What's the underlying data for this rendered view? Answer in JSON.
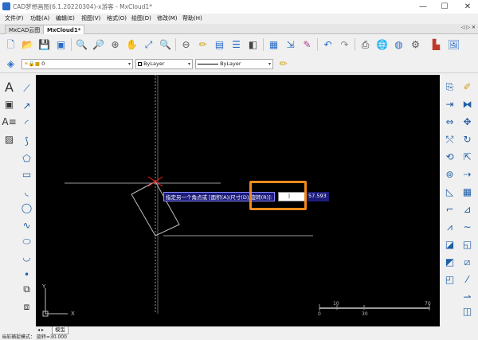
{
  "window": {
    "title": "CAD梦想画图(6.1.20220304)-x游客 - MxCloud1*",
    "minimize": "—",
    "maximize": "☐",
    "close": "✕"
  },
  "menu": [
    {
      "label": "文件(F)"
    },
    {
      "label": "功能(A)"
    },
    {
      "label": "编辑(E)"
    },
    {
      "label": "视图(V)"
    },
    {
      "label": "格式(O)"
    },
    {
      "label": "绘图(D)"
    },
    {
      "label": "修改(M)"
    },
    {
      "label": "帮助(H)"
    }
  ],
  "tabs": {
    "items": [
      {
        "label": "MxCAD云图"
      },
      {
        "label": "MxCloud1*"
      }
    ],
    "nav": "◁ ▷ ✕"
  },
  "layer_bar": {
    "layer_value": "0",
    "color_value": "ByLayer",
    "linetype_value": "ByLayer"
  },
  "command": {
    "prompt": "指定另一个角点或 [面积(A)/尺寸(D)/旋转(R)]:",
    "input_value": "",
    "value_display": "57.593"
  },
  "axis": {
    "x_label": "X",
    "y_label": "Y"
  },
  "scalebar": {
    "left_label": "0",
    "mid_label": "10",
    "mid2_label": "30",
    "right_label": "70"
  },
  "layout_tabs": {
    "nav": "◂ ▸",
    "model": "模型"
  },
  "status": {
    "text": "当前捕捉模式：  旋转=30.000"
  },
  "colors": {
    "canvas": "#000000",
    "highlight": "#f28a1c",
    "tip_bg": "#1c1c7a",
    "crosshair_red": "#ff2020"
  }
}
